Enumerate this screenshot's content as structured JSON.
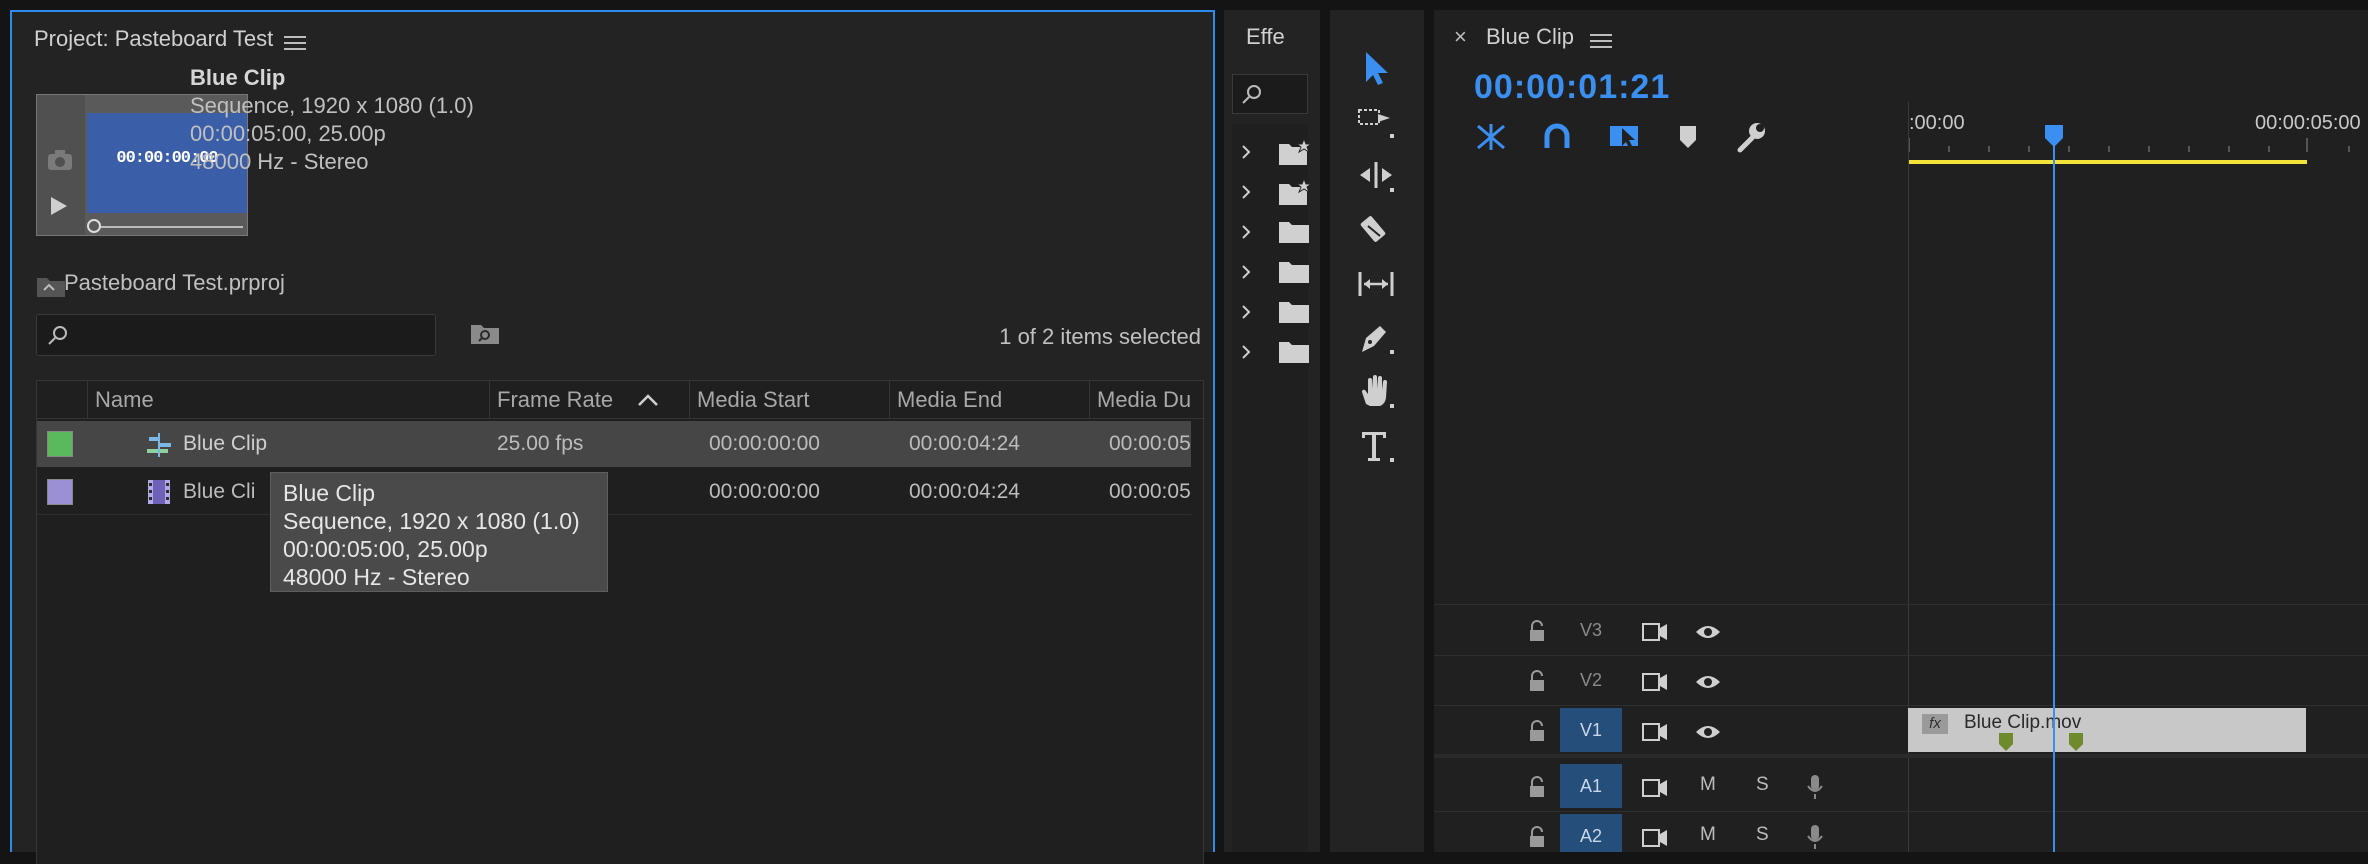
{
  "project": {
    "title": "Project: Pasteboard Test",
    "preview": {
      "name": "Blue Clip",
      "line1": "Sequence, 1920 x 1080 (1.0)",
      "line2": "00:00:05:00, 25.00p",
      "line3": "48000 Hz - Stereo",
      "thumb_timecode": "00:00:00:00"
    },
    "file_name": "Pasteboard Test.prproj",
    "search_placeholder": "",
    "selection_status": "1 of 2 items selected",
    "columns": [
      "Name",
      "Frame Rate",
      "Media Start",
      "Media End",
      "Media Du"
    ],
    "rows": [
      {
        "color": "#5cb85c",
        "name": "Blue Clip",
        "frame_rate": "25.00 fps",
        "media_start": "00:00:00:00",
        "media_end": "00:00:04:24",
        "media_dur": "00:00:05"
      },
      {
        "color": "#9b8fd6",
        "name": "Blue Cli",
        "frame_rate": "",
        "media_start": "00:00:00:00",
        "media_end": "00:00:04:24",
        "media_dur": "00:00:05"
      }
    ],
    "tooltip": {
      "line1": "Blue Clip",
      "line2": "Sequence, 1920 x 1080 (1.0)",
      "line3": "00:00:05:00, 25.00p",
      "line4": "48000 Hz - Stereo"
    }
  },
  "effects": {
    "tab": "Effe",
    "folders": [
      "preset-bin-icon",
      "preset-bin-icon",
      "folder-icon",
      "folder-icon",
      "folder-icon",
      "folder-icon"
    ]
  },
  "tools": [
    "selection-tool",
    "track-select-tool",
    "ripple-edit-tool",
    "razor-tool",
    "slip-tool",
    "pen-tool",
    "hand-tool",
    "type-tool"
  ],
  "timeline": {
    "title": "Blue Clip",
    "timecode": "00:00:01:21",
    "ruler_start": ":00:00",
    "ruler_end": "00:00:05:00",
    "accent": "#2d8ceb",
    "tracks": [
      {
        "name": "V3",
        "kind": "video",
        "active": false
      },
      {
        "name": "V2",
        "kind": "video",
        "active": false
      },
      {
        "name": "V1",
        "kind": "video",
        "active": true
      },
      {
        "name": "A1",
        "kind": "audio",
        "active": true,
        "mute": "M",
        "solo": "S"
      },
      {
        "name": "A2",
        "kind": "audio",
        "active": true,
        "mute": "M",
        "solo": "S"
      }
    ],
    "clip": {
      "name": "Blue Clip.mov",
      "fx": "fx"
    }
  }
}
